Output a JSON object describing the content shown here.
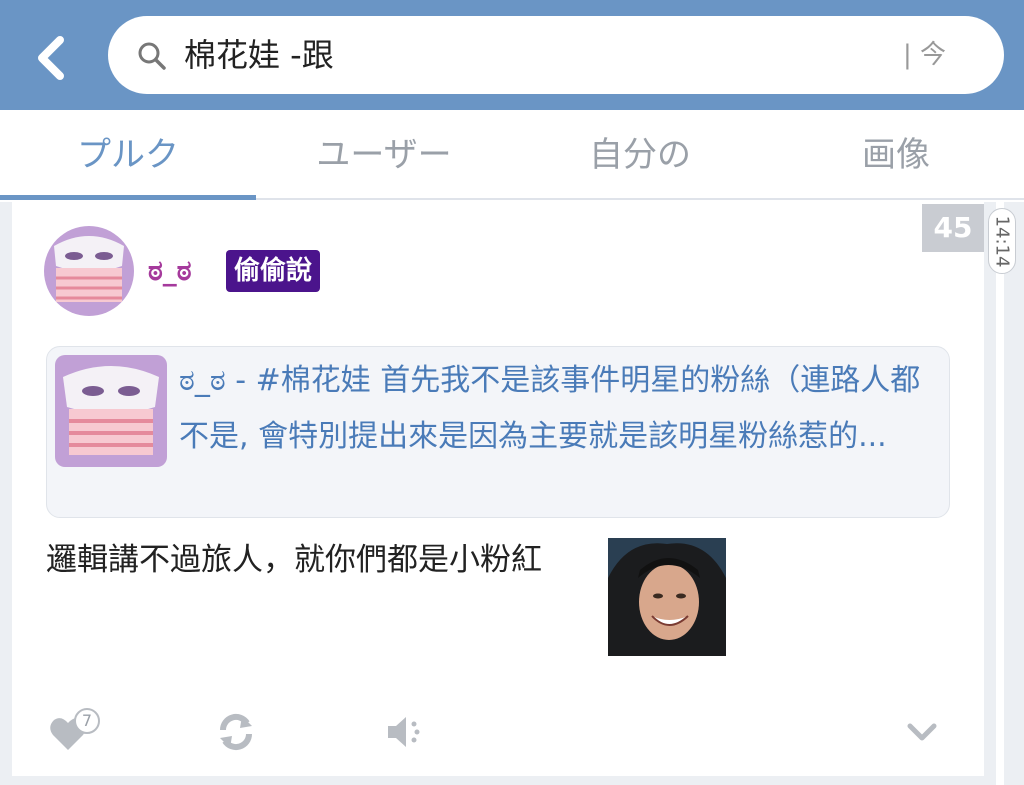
{
  "search": {
    "query": "棉花娃 -跟",
    "ime_hint": "| 今"
  },
  "tabs": [
    {
      "label": "プルク",
      "active": true
    },
    {
      "label": "ユーザー",
      "active": false
    },
    {
      "label": "自分の",
      "active": false
    },
    {
      "label": "画像",
      "active": false
    }
  ],
  "post": {
    "response_count": "45",
    "time": "14:14",
    "nickname": "ಠ_ಠ",
    "qualifier": "偷偷說",
    "quote": {
      "text": "ಠ_ಠ - #棉花娃 首先我不是該事件明星的粉絲（連路人都不是, 會特別提出來是因為主要就是該明星粉絲惹的..."
    },
    "content": "邏輯講不過旅人，就你們都是小粉紅",
    "likes": "7"
  },
  "colors": {
    "header": "#6a95c5",
    "accent": "#6a95c5",
    "nickname": "#a53a9c",
    "qualifier_bg": "#4b148c",
    "quote_link": "#4a7bb8"
  },
  "icons": [
    "back-arrow-icon",
    "search-icon",
    "heart-icon",
    "replurk-icon",
    "mute-icon",
    "chevron-down-icon"
  ]
}
